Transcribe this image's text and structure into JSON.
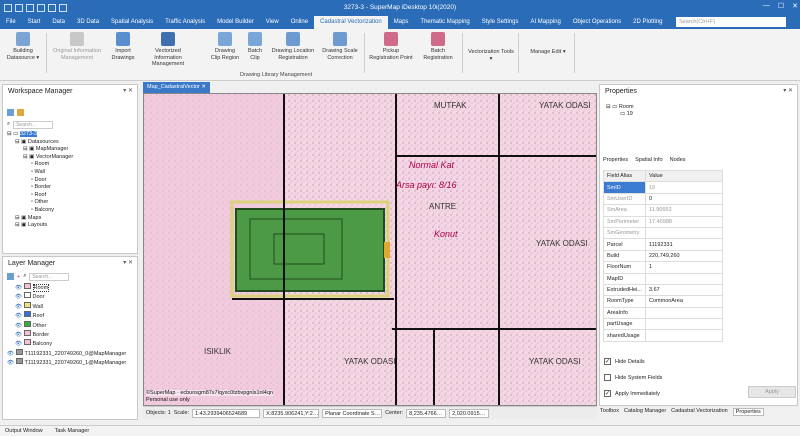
{
  "window": {
    "title": "3273-3 - SuperMap iDesktop 10i(2020)"
  },
  "menu": {
    "tabs": [
      "File",
      "Start",
      "Data",
      "3D Data",
      "Spatial Analysis",
      "Traffic Analysis",
      "Model Builder",
      "View",
      "Online",
      "Cadastral Vectorization",
      "Maps",
      "Thematic Mapping",
      "Style Settings",
      "AI Mapping",
      "Object Operations",
      "2D Plotting"
    ],
    "active": "Cadastral Vectorization",
    "search_placeholder": "Search(Ctrl+F)"
  },
  "ribbon": {
    "buttons": [
      {
        "label": "Building Datasource ▾",
        "disabled": false
      },
      {
        "label": "Original Information Management",
        "disabled": true
      },
      {
        "label": "Import Drawings",
        "disabled": false
      },
      {
        "label": "Vectorized Information Management",
        "disabled": false
      },
      {
        "label": "Drawing Clip Region",
        "disabled": false
      },
      {
        "label": "Batch Clip",
        "disabled": false
      },
      {
        "label": "Drawing Location Registration",
        "disabled": false
      },
      {
        "label": "Drawing Scale Correction",
        "disabled": false
      },
      {
        "label": "Pickup Registration Point",
        "disabled": false
      },
      {
        "label": "Batch Registration",
        "disabled": false
      },
      {
        "label": "Vectorization Tools ▾",
        "disabled": false
      },
      {
        "label": "Manage Edit ▾",
        "disabled": false
      }
    ],
    "group_label": "Drawing Library Management"
  },
  "workspace": {
    "title": "Workspace Manager",
    "search_placeholder": "Search...",
    "tree": [
      "3273-3",
      "Datasources",
      "MapManager",
      "VectorManager",
      "Room",
      "Wall",
      "Door",
      "Border",
      "Roof",
      "Other",
      "Balcony",
      "Maps",
      "Layouts"
    ]
  },
  "layers": {
    "title": "Layer Manager",
    "search_placeholder": "Search...",
    "items": [
      "Room",
      "Door",
      "Wall",
      "Roof",
      "Other",
      "Border",
      "Balcony",
      "T11192331_220749260_0@MapManager",
      "T11192331_220749260_1@MapManager"
    ]
  },
  "map": {
    "tab": "Map_CadastralVector",
    "copyright": "©SuperMap · ecbunsgm87x7lqyxc0tzbvpgnls1nl4qn",
    "personal": "Personal use only",
    "labels": [
      "MUTFAK",
      "YATAK ODASI",
      "Normal Kat",
      "Arsa payı: 8/16",
      "ANTRE",
      "Konut",
      "YATAK ODASI",
      "ISIKLIK",
      "YATAK ODASI",
      "YATAK ODASI"
    ],
    "fill_colors": {
      "pink": "#f6d5e4",
      "green": "#4c9a46",
      "wall": "#d9d27a"
    }
  },
  "status": {
    "objects": "Objects: 1",
    "scale_label": "Scale:",
    "scale_value": "1:43.2939406524689",
    "coords": "X:8235.906241,Y:2…",
    "crs": "Planar Coordinate S…",
    "center_label": "Center:",
    "center_x": "8,235.4766…",
    "center_y": "2,020.0915…"
  },
  "properties": {
    "title": "Properties",
    "tree": [
      "Room",
      "19"
    ],
    "tabs": [
      "Properties",
      "Spatial Info",
      "Nodes"
    ],
    "headers": [
      "Field Alias",
      "Value"
    ],
    "rows": [
      {
        "k": "SmID",
        "v": "19"
      },
      {
        "k": "SmUserID",
        "v": "0"
      },
      {
        "k": "SmArea",
        "v": "11.90653"
      },
      {
        "k": "SmPerimeter",
        "v": "17.46988"
      },
      {
        "k": "SmGeometry",
        "v": ""
      },
      {
        "k": "Parcel",
        "v": "11192331"
      },
      {
        "k": "Build",
        "v": "220,749,260"
      },
      {
        "k": "FloorNum",
        "v": "1"
      },
      {
        "k": "MapID",
        "v": ""
      },
      {
        "k": "ExtrudedHei...",
        "v": "3.67"
      },
      {
        "k": "RoomType",
        "v": "CommonArea"
      },
      {
        "k": "AreaInfo",
        "v": ""
      },
      {
        "k": "partUsage",
        "v": ""
      },
      {
        "k": "sharedUsage",
        "v": ""
      }
    ],
    "hide_details": "Hide Details",
    "hide_system": "Hide System Fields",
    "apply_immediately": "Apply Immediately",
    "apply": "Apply"
  },
  "right_tabs": [
    "Toolbox",
    "Catalog Manager",
    "Cadastral Vectorization",
    "Properties"
  ],
  "bottom_tabs": [
    "Output Window",
    "Task Manager"
  ]
}
